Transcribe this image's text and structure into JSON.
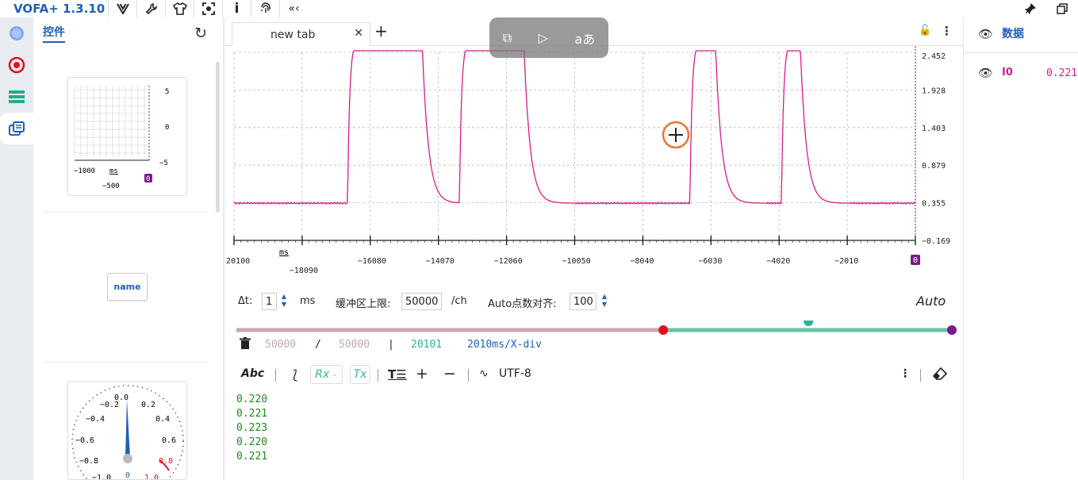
{
  "app": {
    "title": "VOFA+ 1.3.10"
  },
  "toolbar_icons": [
    "vofa-logo-icon",
    "wrench-icon",
    "shirt-icon",
    "camera-scan-icon",
    "info-icon",
    "fingerprint-icon",
    "collapse-icon"
  ],
  "window_controls": [
    "pin-icon",
    "restore-icon"
  ],
  "widgets_panel": {
    "title": "控件",
    "mini_chart": {
      "y_ticks": [
        "5",
        "0",
        "−5"
      ],
      "x_ticks": [
        "−1000",
        "−500"
      ],
      "x_unit": "ms",
      "cursor_label": "0"
    },
    "name_button": "name",
    "gauge": {
      "left_ticks": [
        "−0.2",
        "−0.4",
        "−0.6",
        "−0.8",
        "−1.0"
      ],
      "right_ticks": [
        "0.2",
        "0.4",
        "0.6",
        "0.8",
        "1.0"
      ],
      "top_tick": "0.0",
      "value": "0"
    }
  },
  "tabs": [
    {
      "label": "new tab"
    }
  ],
  "chart_data": {
    "type": "line",
    "y_ticks": [
      "2.452",
      "1.928",
      "1.403",
      "0.879",
      "0.355",
      "−0.169"
    ],
    "ylim": [
      -0.169,
      2.452
    ],
    "x_ticks": [
      "−20100",
      "−18090",
      "−16080",
      "−14070",
      "−12060",
      "−10050",
      "−8040",
      "−6030",
      "−4020",
      "−2010",
      "0"
    ],
    "xlim": [
      -20100,
      0
    ],
    "x_unit": "ms",
    "cursor_label": "0",
    "series": [
      {
        "color": "#d81b8c",
        "pulses": [
          [
            -16750,
            -14550
          ],
          [
            -13450,
            -11550
          ],
          [
            -6650,
            -5900
          ],
          [
            -3950,
            -3400
          ]
        ],
        "baseline": 0.35,
        "clip": 2.6
      }
    ]
  },
  "controls": {
    "dt_label": "Δt:",
    "dt_value": "1",
    "dt_unit": "ms",
    "buffer_label": "缓冲区上限:",
    "buffer_value": "50000",
    "buffer_unit": "/ch",
    "align_label": "Auto点数对齐:",
    "align_value": "100",
    "auto_label": "Auto"
  },
  "range_slider": {
    "left_handle": 0.594,
    "mid_handle": 0.796,
    "right_handle": 1.0,
    "colors": {
      "left": "#c9a8b0",
      "right": "#6cc0a8",
      "red": "#e3101a",
      "teal": "#2bb39a",
      "purple": "#7b1a8c"
    }
  },
  "buffer_status": {
    "count1": "50000",
    "slash": "/",
    "count2": "50000",
    "bar": "|",
    "points": "20101",
    "div": "2010ms/X-div"
  },
  "text_toolbar": {
    "abc": "Abc",
    "rx": "Rx",
    "tx": "Tx",
    "encoding": "UTF-8"
  },
  "log_lines": [
    "0.220",
    "0.221",
    "0.223",
    "0.220",
    "0.221"
  ],
  "data_panel": {
    "title": "数据",
    "channels": [
      {
        "name": "I0",
        "value": "0.221"
      }
    ]
  }
}
